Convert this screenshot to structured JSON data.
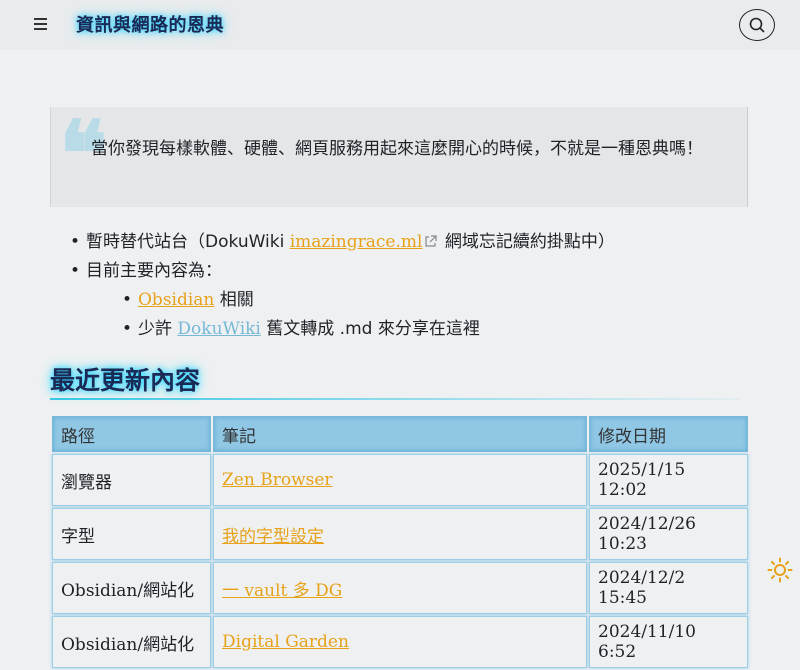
{
  "header": {
    "site_title": "資訊與網路的恩典"
  },
  "quote": {
    "mark": "❝",
    "text": "當你發現每樣軟體、硬體、網頁服務用起來這麼開心的時候，不就是一種恩典嗎！"
  },
  "info": {
    "item1_prefix": "暫時替代站台（DokuWiki ",
    "item1_link": "imazingrace.ml",
    "item1_suffix": " 網域忘記續約掛點中）",
    "item2": "目前主要內容為：",
    "sub1_link": "Obsidian",
    "sub1_suffix": " 相關",
    "sub2_prefix": "少許 ",
    "sub2_link": "DokuWiki",
    "sub2_suffix": " 舊文轉成 .md 來分享在這裡"
  },
  "section": {
    "title": "最近更新內容"
  },
  "table": {
    "headers": [
      "路徑",
      "筆記",
      "修改日期"
    ],
    "rows": [
      {
        "path": "瀏覽器",
        "note": "Zen Browser",
        "date": "2025/1/15 12:02"
      },
      {
        "path": "字型",
        "note": "我的字型設定",
        "date": "2024/12/26 10:23"
      },
      {
        "path": "Obsidian/網站化",
        "note": "一 vault 多 DG",
        "date": "2024/12/2 15:45"
      },
      {
        "path": "Obsidian/網站化",
        "note": "Digital Garden",
        "date": "2024/11/10 6:52"
      }
    ]
  },
  "colors": {
    "accent": "#e8a21a",
    "title_glow": "#2ad4ff",
    "table_header": "#8fc7e4"
  },
  "icons": {
    "menu": "hamburger-menu-icon",
    "search": "search-icon",
    "theme": "sun-icon",
    "external": "external-link-icon"
  }
}
